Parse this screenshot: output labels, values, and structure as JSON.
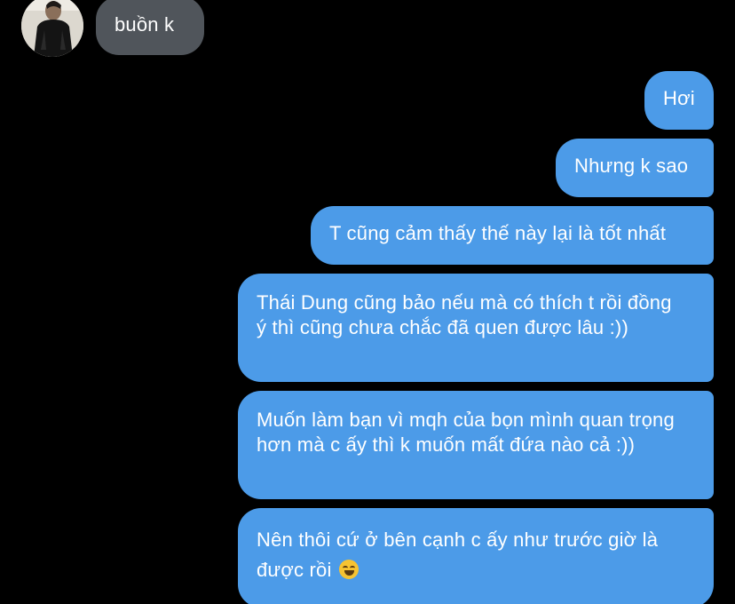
{
  "conversation": {
    "incoming": [
      {
        "text": "buồn k"
      }
    ],
    "outgoing": [
      {
        "text": "Hơi"
      },
      {
        "text": "Nhưng k sao"
      },
      {
        "text": "T cũng cảm thấy thế này lại là tốt nhất"
      },
      {
        "text": "Thái Dung cũng bảo nếu mà có thích t rồi đồng ý thì cũng chưa chắc đã quen được lâu :))"
      },
      {
        "text": "Muốn làm bạn vì mqh của bọn mình quan trọng hơn mà c ấy thì k muốn mất đứa nào cả :))"
      },
      {
        "text": "Nên thôi cứ ở bên cạnh c ấy như trước giờ là được rồi",
        "emoji": "rolling-on-floor-laughing-emoji"
      }
    ]
  },
  "colors": {
    "background": "#000000",
    "incoming_bubble": "#50555b",
    "outgoing_bubble": "#4c9be8",
    "text": "#ffffff"
  }
}
